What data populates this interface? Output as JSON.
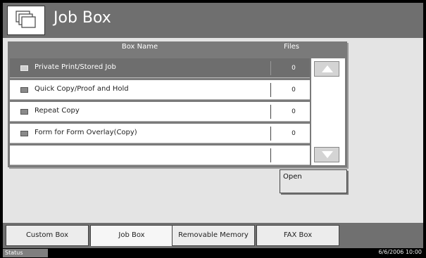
{
  "header": {
    "title": "Job Box",
    "icon": "job-box-icon"
  },
  "list": {
    "columns": {
      "name": "Box Name",
      "files": "Files"
    },
    "rows": [
      {
        "label": "Private Print/Stored Job",
        "files": "0",
        "selected": true
      },
      {
        "label": "Quick Copy/Proof and Hold",
        "files": "0",
        "selected": false
      },
      {
        "label": "Repeat Copy",
        "files": "0",
        "selected": false
      },
      {
        "label": "Form for Form Overlay(Copy)",
        "files": "0",
        "selected": false
      },
      {
        "label": "",
        "files": "",
        "selected": false
      }
    ]
  },
  "actions": {
    "open_label": "Open"
  },
  "tabs": [
    {
      "label": "Custom Box",
      "active": false
    },
    {
      "label": "Job Box",
      "active": true
    },
    {
      "label": "Removable Memory",
      "active": false
    },
    {
      "label": "FAX Box",
      "active": false
    }
  ],
  "status": {
    "label": "Status",
    "datetime": "6/6/2006 10:00"
  }
}
